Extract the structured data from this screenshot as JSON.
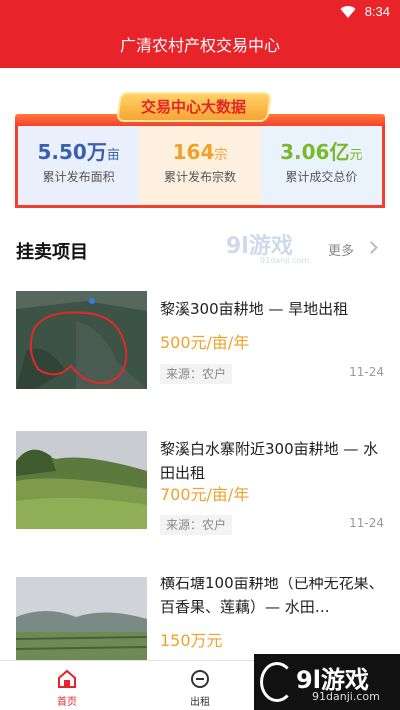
{
  "status_bar": {
    "time": "8:34",
    "wifi_icon": "wifi-icon"
  },
  "header": {
    "title": "广清农村产权交易中心"
  },
  "stats": {
    "title": "交易中心大数据",
    "items": [
      {
        "value": "5.50万",
        "unit": "亩",
        "label": "累计发布面积",
        "color": "#3b5eb0"
      },
      {
        "value": "164",
        "unit": "宗",
        "label": "累计发布宗数",
        "color": "#f0a12c"
      },
      {
        "value": "3.06亿",
        "unit": "元",
        "label": "累计成交总价",
        "color": "#7ab82e"
      }
    ]
  },
  "listings_section": {
    "title": "挂卖项目",
    "more_label": "更多"
  },
  "listings": [
    {
      "title": "黎溪300亩耕地 — 旱地出租",
      "price": "500元/亩/年",
      "source": "来源：农户",
      "date": "11-24"
    },
    {
      "title": "黎溪白水寨附近300亩耕地 — 水田出租",
      "price": "700元/亩/年",
      "source": "来源：农户",
      "date": "11-24"
    },
    {
      "title": "横石塘100亩耕地（已种无花果、百香果、莲藕）— 水田…",
      "price": "150万元"
    }
  ],
  "tabbar": {
    "home_label": "首页",
    "out_label": "出租"
  },
  "watermarks": {
    "mid_text": "9l游戏",
    "mid_url": "91danji.com",
    "corner_text": "9l游戏",
    "corner_url": "91danji.com"
  },
  "colors": {
    "brand_red": "#e8232a",
    "price_orange": "#f0a12c"
  }
}
